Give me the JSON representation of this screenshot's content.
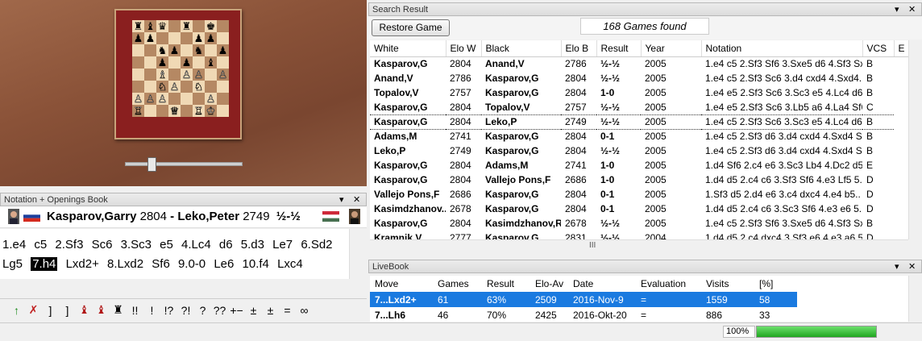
{
  "notation_pane": {
    "title": "Notation + Openings Book",
    "white_name": "Kasparov,Garry",
    "white_elo": "2804",
    "separator": "-",
    "black_name": "Leko,Peter",
    "black_elo": "2749",
    "result": "½-½",
    "moves": [
      "1.e4",
      "c5",
      "2.Sf3",
      "Sc6",
      "3.Sc3",
      "e5",
      "4.Lc4",
      "d6",
      "5.d3",
      "Le7",
      "6.Sd2",
      "Lg5",
      "7.h4",
      "Lxd2+",
      "8.Lxd2",
      "Sf6",
      "9.0-0",
      "Le6",
      "10.f4",
      "Lxc4"
    ],
    "current_move": "7.h4",
    "toolbar": [
      "↑",
      "✗",
      "]",
      "]",
      "♝",
      "♝",
      "♜",
      "!!",
      "!",
      "!?",
      "?!",
      "?",
      "??",
      "+−",
      "±",
      "±",
      "=",
      "∞"
    ]
  },
  "search_result": {
    "title": "Search Result",
    "restore_label": "Restore Game",
    "games_found": "168 Games found",
    "columns": [
      "White",
      "Elo W",
      "Black",
      "Elo B",
      "Result",
      "Year",
      "Notation",
      "VCS",
      "E"
    ],
    "rows": [
      [
        "Kasparov,G",
        "2804",
        "Anand,V",
        "2786",
        "½-½",
        "2005",
        "1.e4 c5 2.Sf3 Sf6 3.Sxe5 d6 4.Sf3 Sx..",
        "B"
      ],
      [
        "Anand,V",
        "2786",
        "Kasparov,G",
        "2804",
        "½-½",
        "2005",
        "1.e4 c5 2.Sf3 Sc6 3.d4 cxd4 4.Sxd4..",
        "B"
      ],
      [
        "Topalov,V",
        "2757",
        "Kasparov,G",
        "2804",
        "1-0",
        "2005",
        "1.e4 e5 2.Sf3 Sc6 3.Sc3 e5 4.Lc4 d6..",
        "B"
      ],
      [
        "Kasparov,G",
        "2804",
        "Topalov,V",
        "2757",
        "½-½",
        "2005",
        "1.e4 e5 2.Sf3 Sc6 3.Lb5 a6 4.La4 Sf6..",
        "C"
      ],
      [
        "Kasparov,G",
        "2804",
        "Leko,P",
        "2749",
        "½-½",
        "2005",
        "1.e4 c5 2.Sf3 Sc6 3.Sc3 e5 4.Lc4 d6..",
        "B"
      ],
      [
        "Adams,M",
        "2741",
        "Kasparov,G",
        "2804",
        "0-1",
        "2005",
        "1.e4 c5 2.Sf3 d6 3.d4 cxd4 4.Sxd4 S..",
        "B"
      ],
      [
        "Leko,P",
        "2749",
        "Kasparov,G",
        "2804",
        "½-½",
        "2005",
        "1.e4 c5 2.Sf3 d6 3.d4 cxd4 4.Sxd4 S..",
        "B"
      ],
      [
        "Kasparov,G",
        "2804",
        "Adams,M",
        "2741",
        "1-0",
        "2005",
        "1.d4 Sf6 2.c4 e6 3.Sc3 Lb4 4.Dc2 d5..",
        "E"
      ],
      [
        "Kasparov,G",
        "2804",
        "Vallejo Pons,F",
        "2686",
        "1-0",
        "2005",
        "1.d4 d5 2.c4 c6 3.Sf3 Sf6 4.e3 Lf5 5..",
        "D"
      ],
      [
        "Vallejo Pons,F",
        "2686",
        "Kasparov,G",
        "2804",
        "0-1",
        "2005",
        "1.Sf3 d5 2.d4 e6 3.c4 dxc4 4.e4 b5..",
        "D"
      ],
      [
        "Kasimdzhanov...",
        "2678",
        "Kasparov,G",
        "2804",
        "0-1",
        "2005",
        "1.d4 d5 2.c4 c6 3.Sc3 Sf6 4.e3 e6 5..",
        "D"
      ],
      [
        "Kasparov,G",
        "2804",
        "Kasimdzhanov,R",
        "2678",
        "½-½",
        "2005",
        "1.e4 c5 2.Sf3 Sf6 3.Sxe5 d6 4.Sf3 Sx..",
        "B"
      ],
      [
        "Kramnik,V",
        "2777",
        "Kasparov,G",
        "2831",
        "½-½",
        "2004",
        "1.d4 d5 2.c4 dxc4 3.Sf3 e6 4.e3 a6 5..",
        "D"
      ]
    ],
    "selected_row": 4,
    "hscroll_label": "III"
  },
  "livebook": {
    "title": "LiveBook",
    "columns": [
      "Move",
      "Games",
      "Result",
      "Elo-Av",
      "Date",
      "Evaluation",
      "Visits",
      "[%]"
    ],
    "rows": [
      [
        "7...Lxd2+",
        "61",
        "63%",
        "2509",
        "2016-Nov-9",
        "=",
        "1559",
        "58"
      ],
      [
        "7...Lh6",
        "46",
        "70%",
        "2425",
        "2016-Okt-20",
        "=",
        "886",
        "33"
      ]
    ]
  },
  "status": {
    "percent": "100%",
    "progress": 1.0
  },
  "colors": {
    "selection_blue": "#1a7ae0",
    "board_light": "#f0d9b5",
    "board_dark": "#b58863",
    "frame_red": "#8a1f1f",
    "progress_green": "#1fa71f"
  }
}
